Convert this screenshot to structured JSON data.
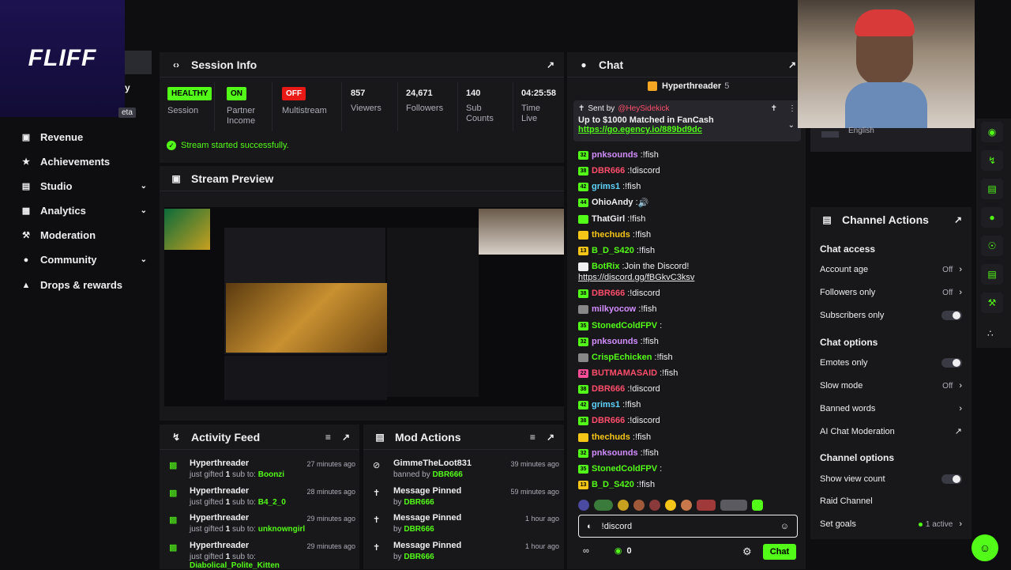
{
  "brand": {
    "logo_text": "FLIFF"
  },
  "nav": {
    "items": [
      {
        "label": "Revenue",
        "icon": "bar-chart-icon"
      },
      {
        "label": "Achievements",
        "icon": "trophy-icon"
      },
      {
        "label": "Studio",
        "icon": "studio-icon"
      },
      {
        "label": "Analytics",
        "icon": "analytics-icon"
      },
      {
        "label": "Moderation",
        "icon": "wrench-icon"
      },
      {
        "label": "Community",
        "icon": "people-icon"
      },
      {
        "label": "Drops & rewards",
        "icon": "drops-icon"
      }
    ],
    "partial_labels": [
      "y",
      "eta"
    ]
  },
  "session": {
    "title": "Session Info",
    "stats": [
      {
        "badge": "HEALTHY",
        "label": "Session"
      },
      {
        "badge": "ON",
        "label": "Partner Income"
      },
      {
        "badge": "OFF",
        "label": "Multistream"
      },
      {
        "value": "857",
        "label": "Viewers"
      },
      {
        "value": "24,671",
        "label": "Followers"
      },
      {
        "value": "140",
        "label": "Sub Counts"
      },
      {
        "value": "04:25:58",
        "label": "Time Live"
      }
    ],
    "status_message": "Stream started successfully."
  },
  "preview": {
    "title": "Stream Preview"
  },
  "activity": {
    "title": "Activity Feed",
    "items": [
      {
        "user": "Hyperthreader",
        "prefix": "just gifted",
        "count": "1",
        "middle": "sub to:",
        "target": "Boonzi",
        "ago": "27 minutes ago"
      },
      {
        "user": "Hyperthreader",
        "prefix": "just gifted",
        "count": "1",
        "middle": "sub to:",
        "target": "B4_2_0",
        "ago": "28 minutes ago"
      },
      {
        "user": "Hyperthreader",
        "prefix": "just gifted",
        "count": "1",
        "middle": "sub to:",
        "target": "unknowngirl",
        "ago": "29 minutes ago"
      },
      {
        "user": "Hyperthreader",
        "prefix": "just gifted",
        "count": "1",
        "middle": "sub to:",
        "target": "Diabolical_Polite_Kitten",
        "ago": "29 minutes ago"
      }
    ]
  },
  "mod": {
    "title": "Mod Actions",
    "items": [
      {
        "title": "GimmeTheLoot831",
        "prefix": "banned by",
        "by": "DBR666",
        "ago": "39 minutes ago",
        "icon": "ban-icon"
      },
      {
        "title": "Message Pinned",
        "prefix": "by",
        "by": "DBR666",
        "ago": "59 minutes ago",
        "icon": "pin-icon"
      },
      {
        "title": "Message Pinned",
        "prefix": "by",
        "by": "DBR666",
        "ago": "1 hour ago",
        "icon": "pin-icon"
      },
      {
        "title": "Message Pinned",
        "prefix": "by",
        "by": "DBR666",
        "ago": "1 hour ago",
        "icon": "pin-icon"
      }
    ]
  },
  "chat": {
    "title": "Chat",
    "top_gifter": {
      "name": "Hyperthreader",
      "count": "5"
    },
    "pinned": {
      "sent_by_label": "Sent by",
      "sender": "@HeySidekick",
      "text": "Up to $1000 Matched in FanCash",
      "link": "https://go.egency.io/889bd9dc"
    },
    "messages": [
      {
        "badge": "32",
        "badge_color": "#53fc18",
        "user": "pnksounds",
        "color": "#d28dff",
        "text": "!fish"
      },
      {
        "badge": "38",
        "badge_color": "#53fc18",
        "user": "DBR666",
        "color": "#ff4d6a",
        "text": "!discord"
      },
      {
        "badge": "42",
        "badge_color": "#53fc18",
        "user": "grims1",
        "color": "#5fd4ff",
        "text": "!fish"
      },
      {
        "badge": "44",
        "badge_color": "#53fc18",
        "user": "OhioAndy",
        "color": "#efeff1",
        "text": "🔊"
      },
      {
        "badge": "",
        "badge_color": "#53fc18",
        "user": "ThatGirl",
        "color": "#efeff1",
        "text": "!fish"
      },
      {
        "badge": "",
        "badge_color": "#f5c518",
        "user": "thechuds",
        "color": "#f5c518",
        "text": "!fish"
      },
      {
        "badge": "13",
        "badge_color": "#f5c518",
        "user": "B_D_S420",
        "color": "#53fc18",
        "text": "!fish"
      },
      {
        "badge": "",
        "badge_color": "#efeff1",
        "user": "BotRix",
        "color": "#53fc18",
        "text": "Join the Discord!",
        "link": "https://discord.gg/fBGkvC3ksv"
      },
      {
        "badge": "38",
        "badge_color": "#53fc18",
        "user": "DBR666",
        "color": "#ff4d6a",
        "text": "!discord"
      },
      {
        "badge": "",
        "badge_color": "#888888",
        "user": "milkyocow",
        "color": "#d28dff",
        "text": "!fish"
      },
      {
        "badge": "35",
        "badge_color": "#53fc18",
        "user": "StonedColdFPV",
        "color": "#53fc18",
        "text": ""
      },
      {
        "badge": "32",
        "badge_color": "#53fc18",
        "user": "pnksounds",
        "color": "#d28dff",
        "text": "!fish"
      },
      {
        "badge": "",
        "badge_color": "#888888",
        "user": "CrispEchicken",
        "color": "#53fc18",
        "text": "!fish"
      },
      {
        "badge": "22",
        "badge_color": "#ff4d9a",
        "user": "BUTMAMASAID",
        "color": "#ff4d6a",
        "text": "!fish"
      },
      {
        "badge": "38",
        "badge_color": "#53fc18",
        "user": "DBR666",
        "color": "#ff4d6a",
        "text": "!discord"
      },
      {
        "badge": "42",
        "badge_color": "#53fc18",
        "user": "grims1",
        "color": "#5fd4ff",
        "text": "!fish"
      },
      {
        "badge": "38",
        "badge_color": "#53fc18",
        "user": "DBR666",
        "color": "#ff4d6a",
        "text": "!discord"
      },
      {
        "badge": "",
        "badge_color": "#f5c518",
        "user": "thechuds",
        "color": "#f5c518",
        "text": "!fish"
      },
      {
        "badge": "32",
        "badge_color": "#53fc18",
        "user": "pnksounds",
        "color": "#d28dff",
        "text": "!fish"
      },
      {
        "badge": "35",
        "badge_color": "#53fc18",
        "user": "StonedColdFPV",
        "color": "#53fc18",
        "text": ""
      },
      {
        "badge": "13",
        "badge_color": "#f5c518",
        "user": "B_D_S420",
        "color": "#53fc18",
        "text": "!fish"
      }
    ],
    "input_value": "!discord",
    "viewer_count": "0",
    "send_label": "Chat"
  },
  "channel_actions": {
    "title": "Channel Actions",
    "language": "English",
    "sections": {
      "chat_access": "Chat access",
      "chat_options": "Chat options",
      "channel_options": "Channel options"
    },
    "account_age": {
      "label": "Account age",
      "value": "Off"
    },
    "followers_only": {
      "label": "Followers only",
      "value": "Off"
    },
    "subscribers_only": {
      "label": "Subscribers only"
    },
    "emotes_only": {
      "label": "Emotes only"
    },
    "slow_mode": {
      "label": "Slow mode",
      "value": "Off"
    },
    "banned_words": {
      "label": "Banned words"
    },
    "ai_moderation": {
      "label": "AI Chat Moderation"
    },
    "show_view_count": {
      "label": "Show view count"
    },
    "raid_channel": {
      "label": "Raid Channel"
    },
    "set_goals": {
      "label": "Set goals",
      "value": "1 active"
    }
  },
  "colors": {
    "accent": "#53fc18",
    "panel": "#18181b",
    "background": "#0e0e10",
    "danger": "#e91916"
  }
}
